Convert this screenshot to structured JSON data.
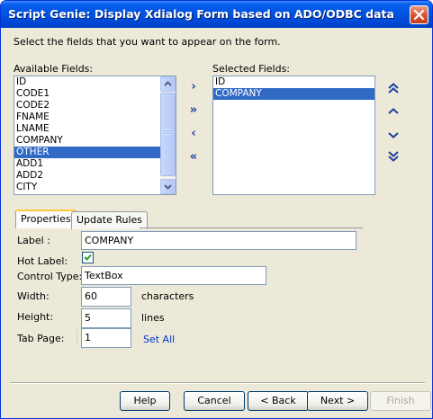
{
  "window": {
    "title": "Script Genie:  Display Xdialog Form based on ADO/ODBC data"
  },
  "instructions": "Select the fields that you want to appear on the form.",
  "available_fields": {
    "label": "Available Fields:",
    "items": [
      "ID",
      "CODE1",
      "CODE2",
      "FNAME",
      "LNAME",
      "COMPANY",
      "OTHER",
      "ADD1",
      "ADD2",
      "CITY"
    ],
    "selected_item": "OTHER"
  },
  "selected_fields": {
    "label": "Selected Fields:",
    "items": [
      "ID",
      "COMPANY"
    ],
    "selected_item": "COMPANY"
  },
  "move_buttons": {
    "add_one": "›",
    "add_all": "»",
    "remove_one": "‹",
    "remove_all": "«"
  },
  "order_buttons": {
    "move_top": "︽",
    "move_up": "︿",
    "move_down": "﹀",
    "move_bottom": "︾"
  },
  "tabs": [
    {
      "label": "Properties",
      "active": true
    },
    {
      "label": "Update Rules",
      "active": false
    }
  ],
  "properties": {
    "label_caption": "Label :",
    "label_value": "COMPANY",
    "hot_label_caption": "Hot Label:",
    "hot_label_checked": true,
    "control_type_caption": "Control Type:",
    "control_type_value": "TextBox",
    "width_caption": "Width:",
    "width_value": "60",
    "width_unit": "characters",
    "height_caption": "Height:",
    "height_value": "5",
    "height_unit": "lines",
    "tab_page_caption": "Tab Page:",
    "tab_page_value": "1",
    "set_all_link": "Set All"
  },
  "footer": {
    "help": "Help",
    "cancel": "Cancel",
    "back": "< Back",
    "next": "Next >",
    "finish": "Finish"
  },
  "colors": {
    "titlebar": "#0054E3",
    "selection": "#316AC5",
    "dialog_bg": "#ECE9D8"
  }
}
